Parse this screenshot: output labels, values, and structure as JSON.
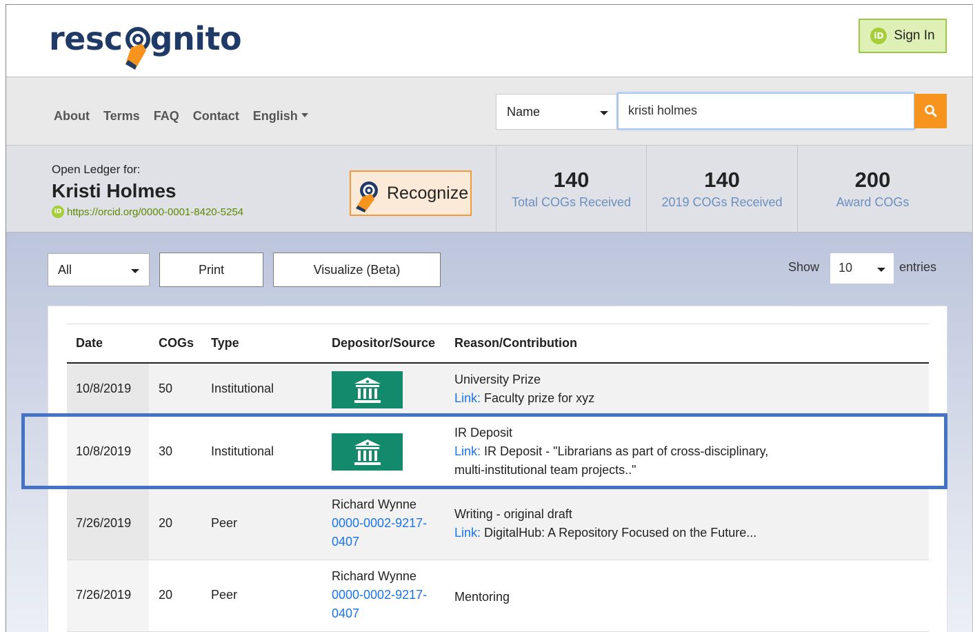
{
  "header": {
    "logo_pre": "resc",
    "logo_post": "gnito",
    "sign_in": "Sign In"
  },
  "nav": {
    "links": [
      "About",
      "Terms",
      "FAQ",
      "Contact",
      "English"
    ],
    "search_type": "Name",
    "search_value": "kristi holmes"
  },
  "ledger": {
    "label": "Open Ledger for:",
    "name": "Kristi Holmes",
    "orcid": "https://orcid.org/0000-0001-8420-5254",
    "recognize": "Recognize",
    "stats": [
      {
        "num": "140",
        "label": "Total COGs Received"
      },
      {
        "num": "140",
        "label": "2019 COGs Received"
      },
      {
        "num": "200",
        "label": "Award COGs"
      }
    ]
  },
  "controls": {
    "filter": "All",
    "print": "Print",
    "visualize": "Visualize (Beta)",
    "show": "Show",
    "entries_value": "10",
    "entries": "entries"
  },
  "table": {
    "headers": [
      "Date",
      "COGs",
      "Type",
      "Depositor/Source",
      "Reason/Contribution"
    ],
    "rows": [
      {
        "date": "10/8/2019",
        "cogs": "50",
        "type": "Institutional",
        "reason_title": "University Prize",
        "link_label": "Link:",
        "link_text": "Faculty prize for xyz"
      },
      {
        "date": "10/8/2019",
        "cogs": "30",
        "type": "Institutional",
        "reason_title": "IR Deposit",
        "link_label": "Link:",
        "link_text": "IR Deposit - \"Librarians as part of cross-disciplinary,",
        "link_text2": "multi-institutional team projects..\""
      },
      {
        "date": "7/26/2019",
        "cogs": "20",
        "type": "Peer",
        "dep_name": "Richard Wynne",
        "dep_id1": "0000-0002-9217-",
        "dep_id2": "0407",
        "reason_title": "Writing - original draft",
        "link_label": "Link:",
        "link_text": "DigitalHub: A Repository Focused on the Future..."
      },
      {
        "date": "7/26/2019",
        "cogs": "20",
        "type": "Peer",
        "dep_name": "Richard Wynne",
        "dep_id1": "0000-0002-9217-",
        "dep_id2": "0407",
        "reason_title": "Mentoring"
      }
    ]
  },
  "colors": {
    "brand_blue": "#1f3a66",
    "orange": "#f7941d",
    "orcid_green": "#a6ce39",
    "institution_green": "#138a6c",
    "highlight": "#4472c4"
  }
}
